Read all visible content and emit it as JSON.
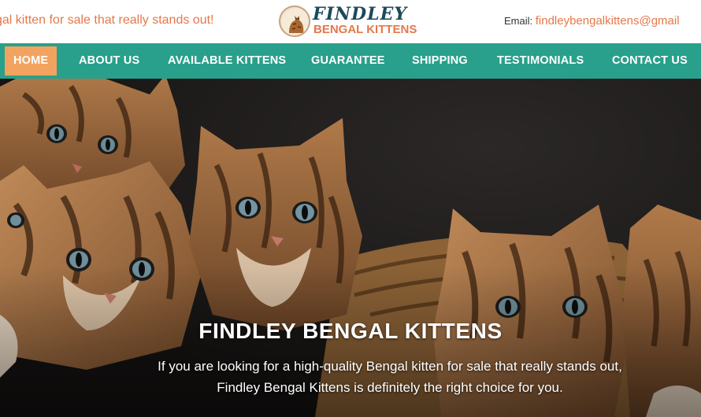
{
  "topbar": {
    "tagline": "gal kitten for sale that really stands out!",
    "logo_title": "FINDLEY",
    "logo_subtitle": "BENGAL KITTENS",
    "email_label": "Email: ",
    "email_value": "findleybengalkittens@gmail"
  },
  "nav": {
    "items": [
      {
        "label": "HOME",
        "active": true
      },
      {
        "label": "ABOUT US"
      },
      {
        "label": "AVAILABLE KITTENS"
      },
      {
        "label": "GUARANTEE"
      },
      {
        "label": "SHIPPING"
      },
      {
        "label": "TESTIMONIALS"
      },
      {
        "label": "CONTACT US"
      }
    ],
    "colors": {
      "background": "#28a08b",
      "active": "#f2a35f",
      "text": "#ffffff"
    }
  },
  "hero": {
    "title": "FINDLEY BENGAL KITTENS",
    "text": "If you are looking for a high-quality Bengal kitten for sale that really stands out, Findley Bengal Kittens is definitely the right choice for you.",
    "image": "bengal-kittens-photo"
  },
  "colors": {
    "accent": "#e4784a",
    "brand_dark": "#1d4a5a"
  }
}
